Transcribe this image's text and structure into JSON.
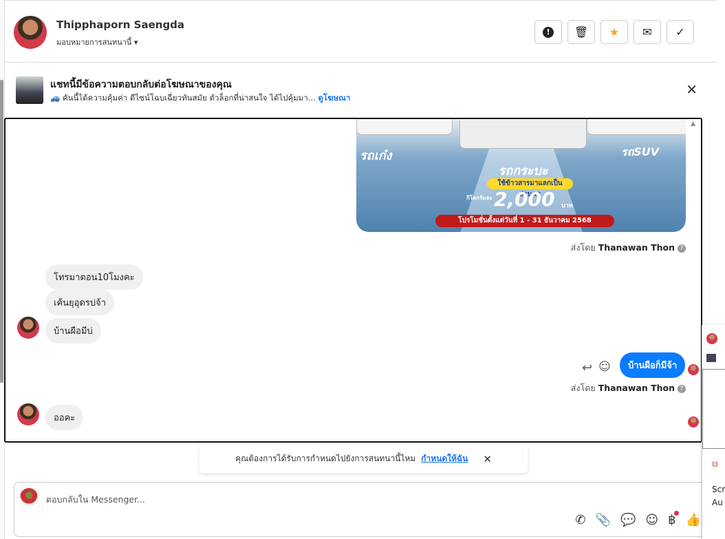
{
  "header": {
    "name": "Thipphaporn Saengda",
    "assign_label": "มอบหมายการสนทนานี้",
    "buttons": [
      "report",
      "delete",
      "star",
      "mark-unread",
      "done"
    ],
    "star_color": "#f5a623"
  },
  "ad_banner": {
    "title": "แชทนี้มีข้อความตอบกลับต่อโฆษณาของคุณ",
    "snippet": "🚙 คันนี้ได้ความคุ้มค่า ดีไซน์โฉบเฉี่ยวทันสมัย ตัวล็อกที่น่าสนใจ ได้ไปคุ้มมา...",
    "link": "ดูโฆษณา"
  },
  "ad_image": {
    "left_label": "รถเก๋ง",
    "center_label": "รถกระบะ",
    "right_label": "รถSUV",
    "badge": "ใช้ข้าวสารมาแลกเป็นส่วนลด",
    "per_kg": "กิโลกรัมละ",
    "amount": "2,000",
    "unit": "บาท",
    "promo": "โปรโมชั่นตั้งแต่วันที่ 1 - 31 ธันวาคม 2568"
  },
  "messages": [
    {
      "from": "page",
      "sent_by_prefix": "ส่งโดย",
      "sent_by": "Thanawan Thon"
    },
    {
      "from": "customer",
      "text": "โทรมาตอน10โมงคะ"
    },
    {
      "from": "customer",
      "text": "เค้นยุอุดรบ่จ้า"
    },
    {
      "from": "customer",
      "text": "บ้านผือมีบ่"
    },
    {
      "from": "page",
      "text": "บ้านผือก็มีจ้า",
      "sent_by_prefix": "ส่งโดย",
      "sent_by": "Thanawan Thon"
    },
    {
      "from": "customer",
      "text": "ออคะ"
    }
  ],
  "assign_prompt": {
    "text": "คุณต้องการได้รับการกำหนดไปยังการสนทนานี้ไหม",
    "link": "กำหนดให้ฉัน"
  },
  "composer": {
    "placeholder": "ตอบกลับใน Messenger...",
    "icons": [
      "call-add",
      "attachment",
      "saved-reply",
      "emoji",
      "payment",
      "like"
    ]
  },
  "side_panel": {
    "line1": "Scr",
    "line2": "Au"
  },
  "accent_color": "#0a7cff"
}
